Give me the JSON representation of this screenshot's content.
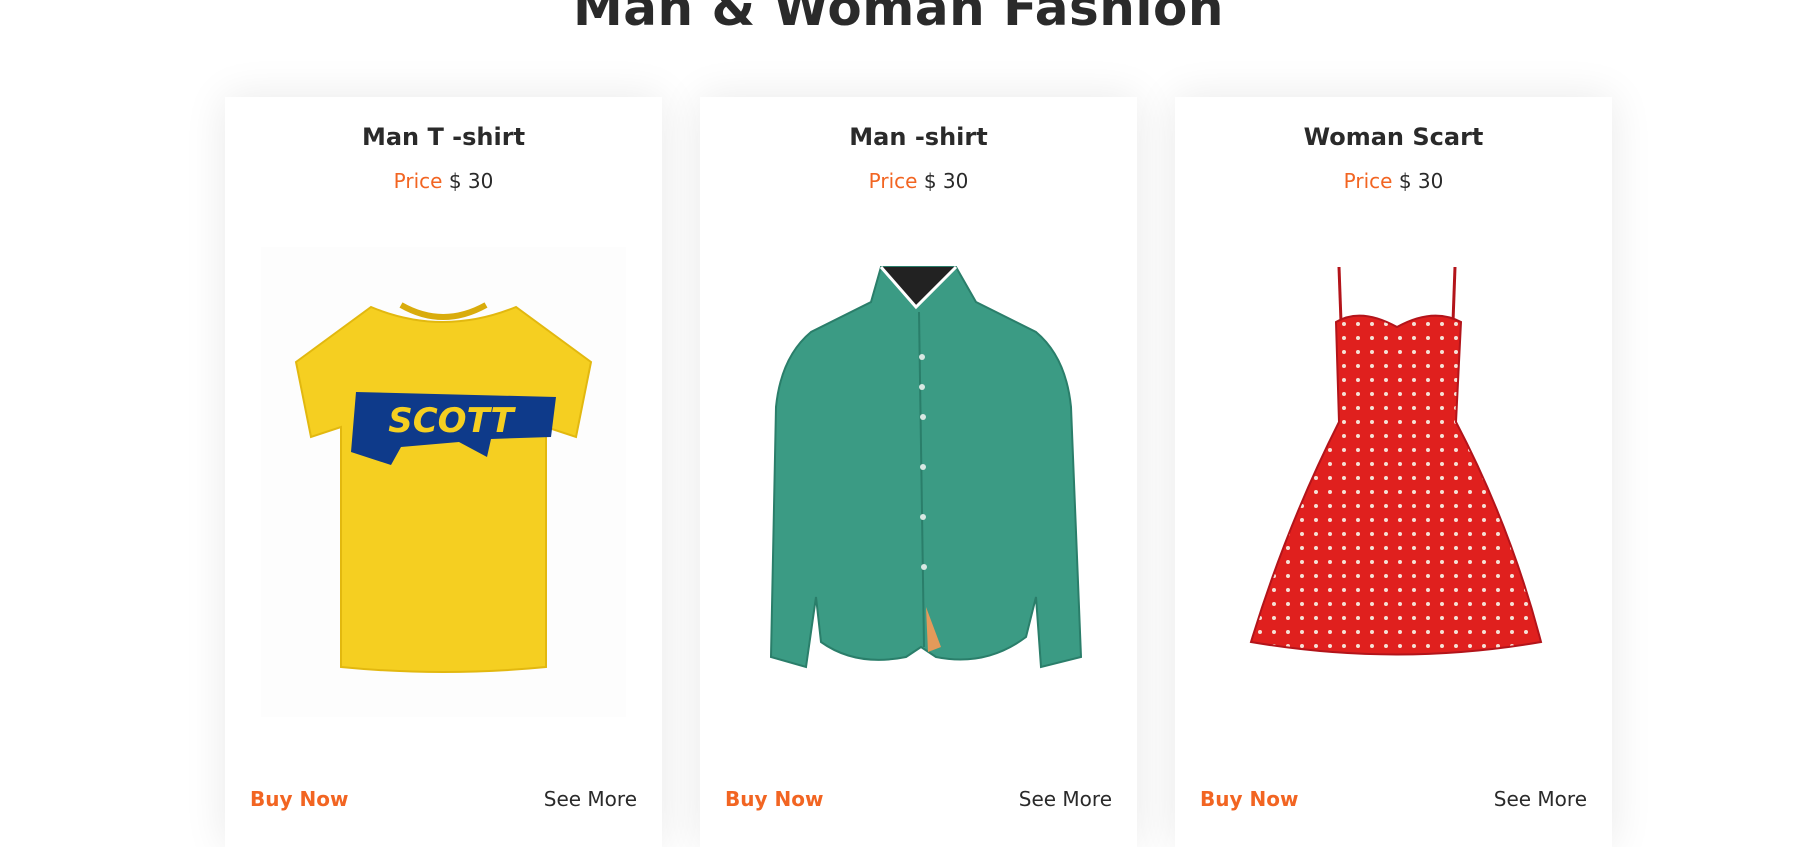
{
  "section": {
    "title": "Man & Woman Fashion"
  },
  "colors": {
    "accent": "#f26522",
    "text": "#2a2a2a"
  },
  "products": [
    {
      "title": "Man T -shirt",
      "price_label": "Price",
      "price_value": "$ 30",
      "image_icon": "yellow-tshirt-image",
      "buy_label": "Buy Now",
      "more_label": "See More"
    },
    {
      "title": "Man -shirt",
      "price_label": "Price",
      "price_value": "$ 30",
      "image_icon": "green-shirt-image",
      "buy_label": "Buy Now",
      "more_label": "See More"
    },
    {
      "title": "Woman Scart",
      "price_label": "Price",
      "price_value": "$ 30",
      "image_icon": "red-polka-dress-image",
      "buy_label": "Buy Now",
      "more_label": "See More"
    }
  ]
}
